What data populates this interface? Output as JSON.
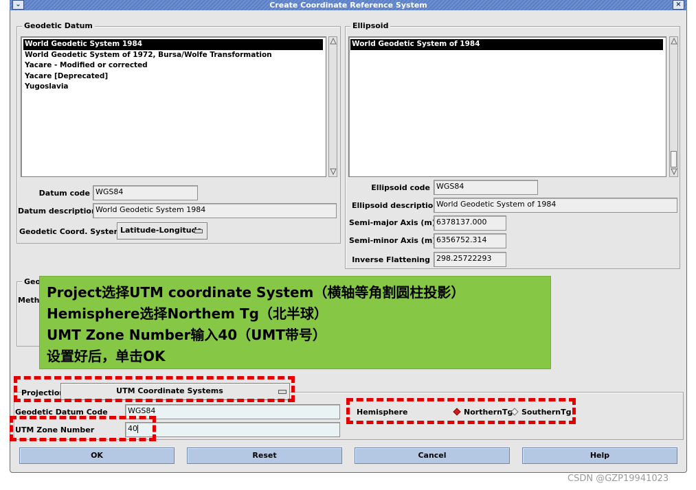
{
  "window": {
    "title": "Create Coordinate Reference System"
  },
  "geodetic_datum": {
    "group_title": "Geodetic Datum",
    "items": [
      "World Geodetic System 1984",
      "World Geodetic System of 1972, Bursa/Wolfe Transformation",
      "Yacare - Modified or corrected",
      "Yacare [Deprecated]",
      "Yugoslavia"
    ],
    "selected_index": 0,
    "datum_code_label": "Datum code",
    "datum_code": "WGS84",
    "datum_description_label": "Datum description",
    "datum_description": "World Geodetic System 1984",
    "coord_system_label": "Geodetic Coord. System",
    "coord_system": "Latitude-Longitude"
  },
  "ellipsoid": {
    "group_title": "Ellipsoid",
    "items": [
      "World Geodetic System of 1984"
    ],
    "ellipsoid_code_label": "Ellipsoid code",
    "ellipsoid_code": "WGS84",
    "ellipsoid_description_label": "Ellipsoid description",
    "ellipsoid_description": "World Geodetic System of 1984",
    "semi_major_label": "Semi-major Axis (m)",
    "semi_major": "6378137.000",
    "semi_minor_label": "Semi-minor Axis (m)",
    "semi_minor": "6356752.314",
    "inverse_flattening_label": "Inverse Flattening",
    "inverse_flattening": "298.25722293"
  },
  "hidden_group": {
    "title_fragment": "Geo",
    "method_fragment": "Metho"
  },
  "callout": {
    "line1": "Project选择UTM coordinate System（横轴等角割圆柱投影）",
    "line2": "Hemisphere选择Northem Tg（北半球）",
    "line3": "UMT Zone Number输入40（UMT带号）",
    "line4": "设置好后，单击OK"
  },
  "projection": {
    "label": "Projection",
    "value": "UTM Coordinate Systems",
    "datum_code_label": "Geodetic Datum Code",
    "datum_code": "WGS84",
    "zone_label": "UTM Zone Number",
    "zone_value": "40",
    "hemisphere_label": "Hemisphere",
    "hemisphere_options": [
      "NorthernTg",
      "SouthernTg"
    ],
    "hemisphere_selected": "NorthernTg"
  },
  "buttons": {
    "ok": "OK",
    "reset": "Reset",
    "cancel": "Cancel",
    "help": "Help"
  },
  "watermark": "CSDN @GZP19941023",
  "colors": {
    "titlebar": "#5b7fc4",
    "callout": "#86c846",
    "highlight": "#e00000",
    "button": "#b4c8e4"
  }
}
